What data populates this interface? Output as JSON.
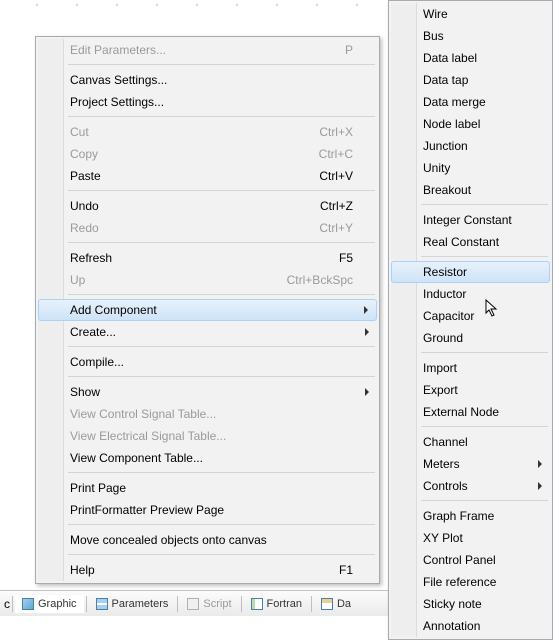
{
  "main_menu": [
    {
      "type": "item",
      "label": "Edit Parameters...",
      "shortcut": "P",
      "disabled": true,
      "name": "edit-parameters"
    },
    {
      "type": "sep"
    },
    {
      "type": "item",
      "label": "Canvas Settings...",
      "name": "canvas-settings"
    },
    {
      "type": "item",
      "label": "Project Settings...",
      "name": "project-settings"
    },
    {
      "type": "sep"
    },
    {
      "type": "item",
      "label": "Cut",
      "shortcut": "Ctrl+X",
      "disabled": true,
      "name": "cut"
    },
    {
      "type": "item",
      "label": "Copy",
      "shortcut": "Ctrl+C",
      "disabled": true,
      "name": "copy"
    },
    {
      "type": "item",
      "label": "Paste",
      "shortcut": "Ctrl+V",
      "name": "paste"
    },
    {
      "type": "sep"
    },
    {
      "type": "item",
      "label": "Undo",
      "shortcut": "Ctrl+Z",
      "name": "undo"
    },
    {
      "type": "item",
      "label": "Redo",
      "shortcut": "Ctrl+Y",
      "disabled": true,
      "name": "redo"
    },
    {
      "type": "sep"
    },
    {
      "type": "item",
      "label": "Refresh",
      "shortcut": "F5",
      "name": "refresh"
    },
    {
      "type": "item",
      "label": "Up",
      "shortcut": "Ctrl+BckSpc",
      "disabled": true,
      "name": "up"
    },
    {
      "type": "sep"
    },
    {
      "type": "item",
      "label": "Add Component",
      "submenu": true,
      "highlight": true,
      "name": "add-component"
    },
    {
      "type": "item",
      "label": "Create...",
      "submenu": true,
      "name": "create"
    },
    {
      "type": "sep"
    },
    {
      "type": "item",
      "label": "Compile...",
      "name": "compile"
    },
    {
      "type": "sep"
    },
    {
      "type": "item",
      "label": "Show",
      "submenu": true,
      "name": "show"
    },
    {
      "type": "item",
      "label": "View Control Signal Table...",
      "disabled": true,
      "name": "view-control-signal-table"
    },
    {
      "type": "item",
      "label": "View Electrical Signal Table...",
      "disabled": true,
      "name": "view-electrical-signal-table"
    },
    {
      "type": "item",
      "label": "View Component Table...",
      "name": "view-component-table"
    },
    {
      "type": "sep"
    },
    {
      "type": "item",
      "label": "Print Page",
      "name": "print-page"
    },
    {
      "type": "item",
      "label": "PrintFormatter Preview Page",
      "name": "printformatter-preview-page"
    },
    {
      "type": "sep"
    },
    {
      "type": "item",
      "label": "Move concealed objects onto canvas",
      "name": "move-concealed-objects"
    },
    {
      "type": "sep"
    },
    {
      "type": "item",
      "label": "Help",
      "shortcut": "F1",
      "name": "help"
    }
  ],
  "sub_menu": [
    {
      "type": "item",
      "label": "Wire",
      "name": "wire"
    },
    {
      "type": "item",
      "label": "Bus",
      "name": "bus"
    },
    {
      "type": "item",
      "label": "Data label",
      "name": "data-label"
    },
    {
      "type": "item",
      "label": "Data tap",
      "name": "data-tap"
    },
    {
      "type": "item",
      "label": "Data merge",
      "name": "data-merge"
    },
    {
      "type": "item",
      "label": "Node label",
      "name": "node-label"
    },
    {
      "type": "item",
      "label": "Junction",
      "name": "junction"
    },
    {
      "type": "item",
      "label": "Unity",
      "name": "unity"
    },
    {
      "type": "item",
      "label": "Breakout",
      "name": "breakout"
    },
    {
      "type": "sep"
    },
    {
      "type": "item",
      "label": "Integer Constant",
      "name": "integer-constant"
    },
    {
      "type": "item",
      "label": "Real Constant",
      "name": "real-constant"
    },
    {
      "type": "sep"
    },
    {
      "type": "item",
      "label": "Resistor",
      "highlight": true,
      "name": "resistor"
    },
    {
      "type": "item",
      "label": "Inductor",
      "name": "inductor"
    },
    {
      "type": "item",
      "label": "Capacitor",
      "name": "capacitor"
    },
    {
      "type": "item",
      "label": "Ground",
      "name": "ground"
    },
    {
      "type": "sep"
    },
    {
      "type": "item",
      "label": "Import",
      "name": "import"
    },
    {
      "type": "item",
      "label": "Export",
      "name": "export"
    },
    {
      "type": "item",
      "label": "External Node",
      "name": "external-node"
    },
    {
      "type": "sep"
    },
    {
      "type": "item",
      "label": "Channel",
      "name": "channel"
    },
    {
      "type": "item",
      "label": "Meters",
      "submenu": true,
      "name": "meters"
    },
    {
      "type": "item",
      "label": "Controls",
      "submenu": true,
      "name": "controls"
    },
    {
      "type": "sep"
    },
    {
      "type": "item",
      "label": "Graph Frame",
      "name": "graph-frame"
    },
    {
      "type": "item",
      "label": "XY Plot",
      "name": "xy-plot"
    },
    {
      "type": "item",
      "label": "Control Panel",
      "name": "control-panel"
    },
    {
      "type": "item",
      "label": "File reference",
      "name": "file-reference"
    },
    {
      "type": "item",
      "label": "Sticky note",
      "name": "sticky-note"
    },
    {
      "type": "item",
      "label": "Annotation",
      "name": "annotation"
    }
  ],
  "tabs": {
    "prefix": "c",
    "graphic": "Graphic",
    "parameters": "Parameters",
    "script": "Script",
    "fortran": "Fortran",
    "dat": "Da"
  }
}
